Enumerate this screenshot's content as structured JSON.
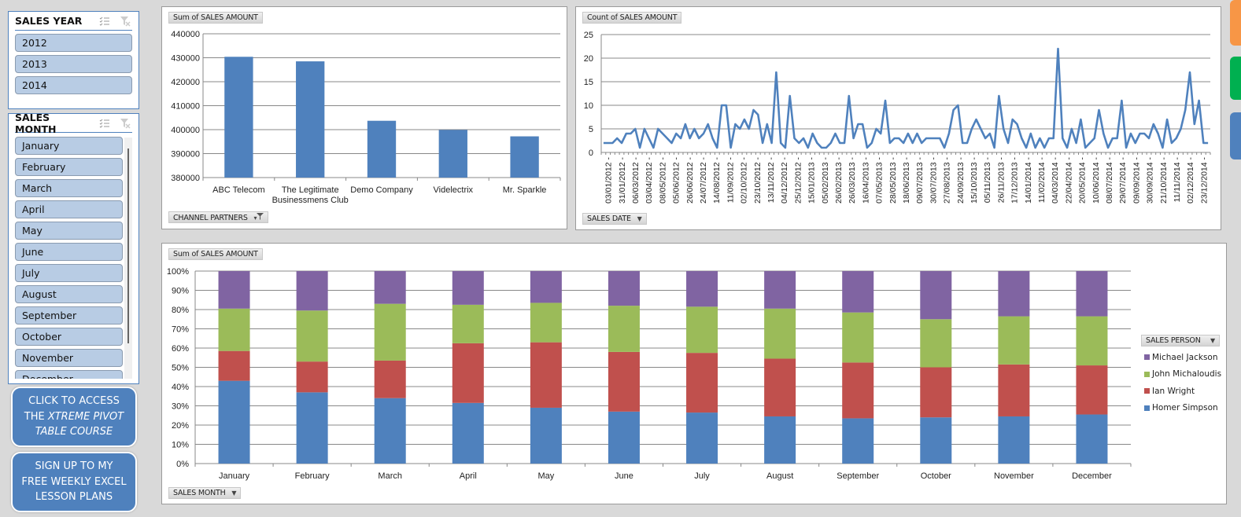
{
  "slicers": {
    "year": {
      "title": "SALES YEAR",
      "items": [
        "2012",
        "2013",
        "2014"
      ]
    },
    "month": {
      "title": "SALES MONTH",
      "items": [
        "January",
        "February",
        "March",
        "April",
        "May",
        "June",
        "July",
        "August",
        "September",
        "October",
        "November",
        "December"
      ]
    }
  },
  "cta": {
    "course": {
      "line1": "CLICK TO ACCESS",
      "line2a": "THE ",
      "line2b": "XTREME PIVOT",
      "line3": "TABLE COURSE"
    },
    "signup": {
      "line1": "SIGN UP TO MY",
      "line2": "FREE WEEKLY EXCEL",
      "line3": "LESSON PLANS"
    }
  },
  "colors": {
    "blue": "#4f81bd",
    "red": "#c0504d",
    "green": "#9bbb59",
    "purple": "#8064a2",
    "orange": "#f79646",
    "tab_green": "#00b050"
  },
  "chart_data": [
    {
      "type": "bar",
      "value_button": "Sum of SALES AMOUNT",
      "axis_button": "CHANNEL PARTNERS",
      "categories": [
        "ABC Telecom",
        "The Legitimate Businessmens Club",
        "Demo Company",
        "Videlectrix",
        "Mr. Sparkle"
      ],
      "category_lines": [
        [
          "ABC Telecom"
        ],
        [
          "The Legitimate",
          "Businessmens Club"
        ],
        [
          "Demo Company"
        ],
        [
          "Videlectrix"
        ],
        [
          "Mr. Sparkle"
        ]
      ],
      "values": [
        430400,
        428500,
        403700,
        399900,
        397200
      ],
      "ylim": [
        380000,
        440000
      ],
      "yticks": [
        "380000",
        "390000",
        "400000",
        "410000",
        "420000",
        "430000",
        "440000"
      ],
      "grid": true
    },
    {
      "type": "line",
      "value_button": "Count of SALES AMOUNT",
      "axis_button": "SALES DATE",
      "ylim": [
        0,
        25
      ],
      "yticks": [
        "0",
        "5",
        "10",
        "15",
        "20",
        "25"
      ],
      "grid": true,
      "x_labels": [
        "03/01/2012",
        "31/01/2012",
        "06/03/2012",
        "03/04/2012",
        "08/05/2012",
        "05/06/2012",
        "26/06/2012",
        "24/07/2012",
        "14/08/2012",
        "11/09/2012",
        "02/10/2012",
        "23/10/2012",
        "13/11/2012",
        "04/12/2012",
        "25/12/2012",
        "15/01/2013",
        "05/02/2013",
        "26/02/2013",
        "26/03/2013",
        "16/04/2013",
        "07/05/2013",
        "28/05/2013",
        "18/06/2013",
        "09/07/2013",
        "30/07/2013",
        "27/08/2013",
        "24/09/2013",
        "15/10/2013",
        "05/11/2013",
        "26/11/2013",
        "17/12/2013",
        "14/01/2014",
        "11/02/2014",
        "04/03/2014",
        "22/04/2014",
        "20/05/2014",
        "10/06/2014",
        "08/07/2014",
        "29/07/2014",
        "09/09/2014",
        "30/09/2014",
        "21/10/2014",
        "11/11/2014",
        "02/12/2014",
        "23/12/2014"
      ],
      "values": [
        2,
        2,
        2,
        3,
        2,
        4,
        4,
        5,
        1,
        5,
        3,
        1,
        5,
        4,
        3,
        2,
        4,
        3,
        6,
        3,
        5,
        3,
        4,
        6,
        3,
        1,
        10,
        10,
        1,
        6,
        5,
        7,
        5,
        9,
        8,
        2,
        6,
        2,
        17,
        2,
        1,
        12,
        3,
        2,
        3,
        1,
        4,
        2,
        1,
        1,
        2,
        4,
        2,
        2,
        12,
        3,
        6,
        6,
        1,
        2,
        5,
        4,
        11,
        2,
        3,
        3,
        2,
        4,
        2,
        4,
        2,
        3,
        3,
        3,
        3,
        1,
        4,
        9,
        10,
        2,
        2,
        5,
        7,
        5,
        3,
        4,
        1,
        12,
        5,
        2,
        7,
        6,
        3,
        1,
        4,
        1,
        3,
        1,
        3,
        3,
        22,
        3,
        1,
        5,
        2,
        7,
        1,
        2,
        3,
        9,
        4,
        1,
        3,
        3,
        11,
        1,
        4,
        2,
        4,
        4,
        3,
        6,
        4,
        1,
        7,
        2,
        3,
        5,
        9,
        17,
        6,
        11,
        2,
        2
      ]
    },
    {
      "type": "bar",
      "stacked": "percent",
      "value_button": "Sum of SALES AMOUNT",
      "axis_button": "SALES MONTH",
      "legend_button": "SALES PERSON",
      "legend_position": "right",
      "categories": [
        "January",
        "February",
        "March",
        "April",
        "May",
        "June",
        "July",
        "August",
        "September",
        "October",
        "November",
        "December"
      ],
      "yticks": [
        "0%",
        "10%",
        "20%",
        "30%",
        "40%",
        "50%",
        "60%",
        "70%",
        "80%",
        "90%",
        "100%"
      ],
      "ylim": [
        0,
        100
      ],
      "series": [
        {
          "name": "Homer Simpson",
          "color": "#4f81bd",
          "values": [
            43,
            37,
            34,
            31.5,
            29,
            27,
            26.5,
            24.5,
            23.5,
            24,
            24.5,
            25.5
          ]
        },
        {
          "name": "Ian Wright",
          "color": "#c0504d",
          "values": [
            15.5,
            16,
            19.5,
            31,
            34,
            31,
            31,
            30,
            29,
            26,
            27,
            25.5
          ]
        },
        {
          "name": "John Michaloudis",
          "color": "#9bbb59",
          "values": [
            22,
            26.5,
            29.5,
            20,
            20.5,
            24,
            24,
            26,
            26,
            25,
            25,
            25.5
          ]
        },
        {
          "name": "Michael Jackson",
          "color": "#8064a2",
          "values": [
            19.5,
            20.5,
            17,
            17.5,
            16.5,
            18,
            18.5,
            19.5,
            21.5,
            25,
            23.5,
            23.5
          ]
        }
      ],
      "legend_order": [
        "Michael Jackson",
        "John Michaloudis",
        "Ian Wright",
        "Homer Simpson"
      ]
    }
  ]
}
